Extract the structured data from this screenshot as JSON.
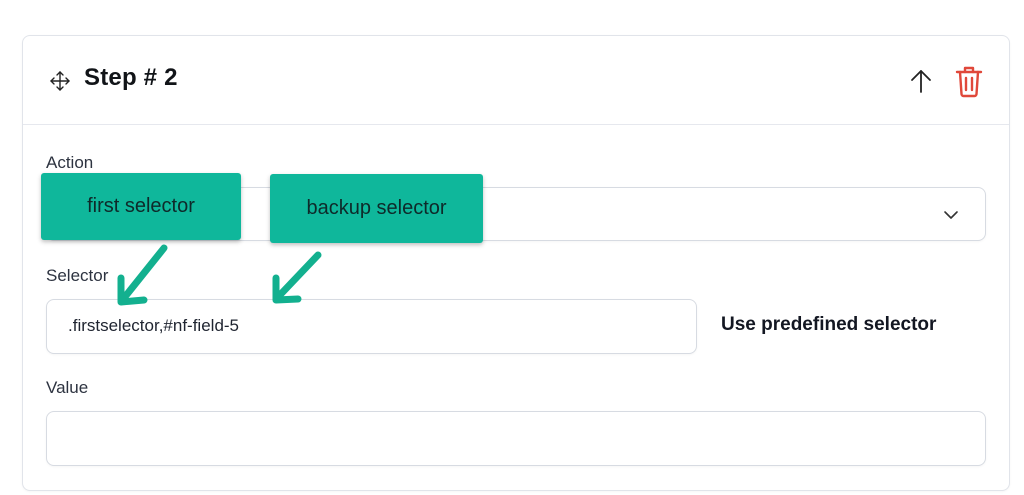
{
  "step": {
    "title": "Step # 2"
  },
  "icons": {
    "move": "move-icon",
    "up": "arrow-up-icon",
    "delete": "trash-icon"
  },
  "action_field": {
    "label": "Action",
    "value": ""
  },
  "selector_field": {
    "label": "Selector",
    "value": ".firstselector,#nf-field-5",
    "predefined_link": "Use predefined selector"
  },
  "value_field": {
    "label": "Value",
    "value": ""
  },
  "annotations": {
    "first": "first selector",
    "backup": "backup selector"
  },
  "colors": {
    "accent_callout": "#0fb79b",
    "delete_red": "#e0483a"
  }
}
